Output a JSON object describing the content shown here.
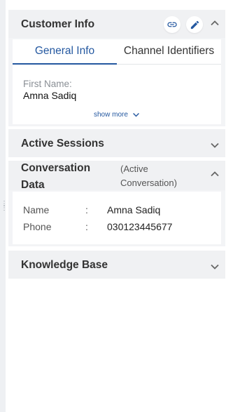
{
  "customer_info": {
    "title": "Customer Info",
    "tabs": [
      {
        "label": "General Info",
        "active": true
      },
      {
        "label": "Channel Identifiers",
        "active": false
      }
    ],
    "fields": [
      {
        "label": "First Name:",
        "value": "Amna Sadiq"
      }
    ],
    "show_more": "show more",
    "icons": [
      "link-icon",
      "pencil-icon",
      "chevron-up-icon"
    ]
  },
  "active_sessions": {
    "title": "Active Sessions",
    "icons": [
      "chevron-down-icon"
    ]
  },
  "conversation_data": {
    "title_line1": "Conversation",
    "title_line2": "Data",
    "subtitle_line1": "(Active",
    "subtitle_line2": "Conversation)",
    "separator": ":",
    "rows": [
      {
        "label": "Name",
        "value": "Amna Sadiq"
      },
      {
        "label": "Phone",
        "value": "030123445677"
      }
    ],
    "icons": [
      "chevron-up-icon"
    ]
  },
  "knowledge_base": {
    "title": "Knowledge Base",
    "icons": [
      "chevron-down-icon"
    ]
  },
  "colors": {
    "accent": "#2458a0",
    "panel_bg": "#f0f1f3",
    "text": "#333333"
  }
}
